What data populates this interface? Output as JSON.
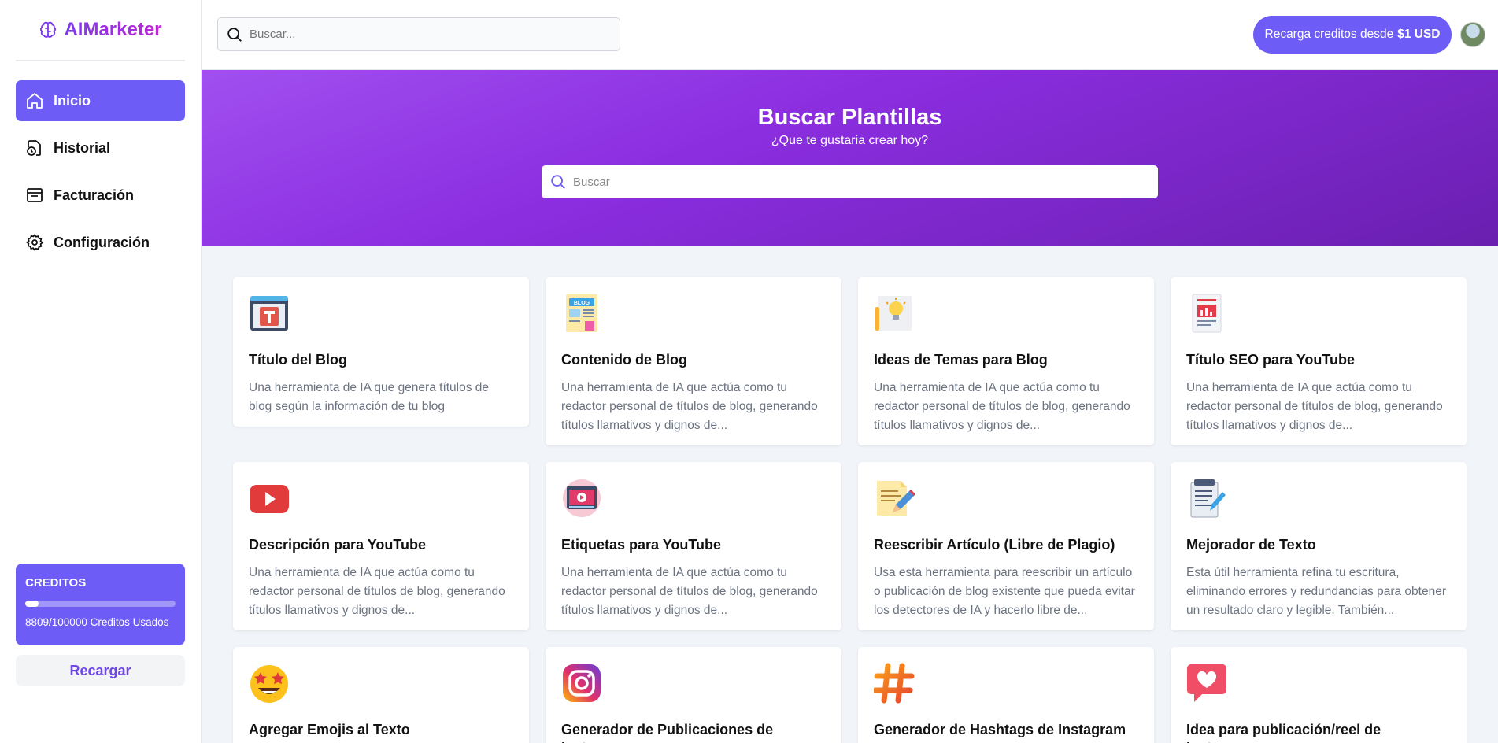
{
  "app": {
    "name": "AIMarketer"
  },
  "sidebar": {
    "items": [
      {
        "label": "Inicio",
        "icon": "home-icon",
        "active": true
      },
      {
        "label": "Historial",
        "icon": "history-icon",
        "active": false
      },
      {
        "label": "Facturación",
        "icon": "billing-icon",
        "active": false
      },
      {
        "label": "Configuración",
        "icon": "gear-icon",
        "active": false
      }
    ],
    "credits": {
      "title": "CREDITOS",
      "used_text": "8809/100000 Creditos Usados",
      "used_fraction": 0.088
    },
    "recharge_label": "Recargar"
  },
  "topbar": {
    "search_placeholder": "Buscar...",
    "topup_label": "Recarga creditos desde",
    "topup_amount": "$1 USD"
  },
  "hero": {
    "title": "Buscar Plantillas",
    "subtitle": "¿Que te gustaria crear hoy?",
    "search_placeholder": "Buscar"
  },
  "templates": [
    {
      "title": "Título del Blog",
      "desc": "Una herramienta de IA que genera títulos de blog según la información de tu blog",
      "icon": "blog-title-icon"
    },
    {
      "title": "Contenido de Blog",
      "desc": "Una herramienta de IA que actúa como tu redactor personal de títulos de blog, generando títulos llamativos y dignos de...",
      "icon": "blog-content-icon"
    },
    {
      "title": "Ideas de Temas para Blog",
      "desc": "Una herramienta de IA que actúa como tu redactor personal de títulos de blog, generando títulos llamativos y dignos de...",
      "icon": "lightbulb-idea-icon"
    },
    {
      "title": "Título SEO para YouTube",
      "desc": "Una herramienta de IA que actúa como tu redactor personal de títulos de blog, generando títulos llamativos y dignos de...",
      "icon": "seo-report-icon"
    },
    {
      "title": "Descripción para YouTube",
      "desc": "Una herramienta de IA que actúa como tu redactor personal de títulos de blog, generando títulos llamativos y dignos de...",
      "icon": "youtube-icon"
    },
    {
      "title": "Etiquetas para YouTube",
      "desc": "Una herramienta de IA que actúa como tu redactor personal de títulos de blog, generando títulos llamativos y dignos de...",
      "icon": "video-player-icon"
    },
    {
      "title": "Reescribir Artículo (Libre de Plagio)",
      "desc": "Usa esta herramienta para reescribir un artículo o publicación de blog existente que pueda evitar los detectores de IA y hacerlo libre de...",
      "icon": "document-pencil-icon"
    },
    {
      "title": "Mejorador de Texto",
      "desc": "Esta útil herramienta refina tu escritura, eliminando errores y redundancias para obtener un resultado claro y legible. También...",
      "icon": "notepad-pencil-icon"
    },
    {
      "title": "Agregar Emojis al Texto",
      "desc": "",
      "icon": "star-struck-emoji-icon"
    },
    {
      "title": "Generador de Publicaciones de Instagram",
      "desc": "",
      "icon": "instagram-icon"
    },
    {
      "title": "Generador de Hashtags de Instagram",
      "desc": "",
      "icon": "hashtag-icon"
    },
    {
      "title": "Idea para publicación/reel de Instagram",
      "desc": "",
      "icon": "heart-message-icon"
    }
  ]
}
